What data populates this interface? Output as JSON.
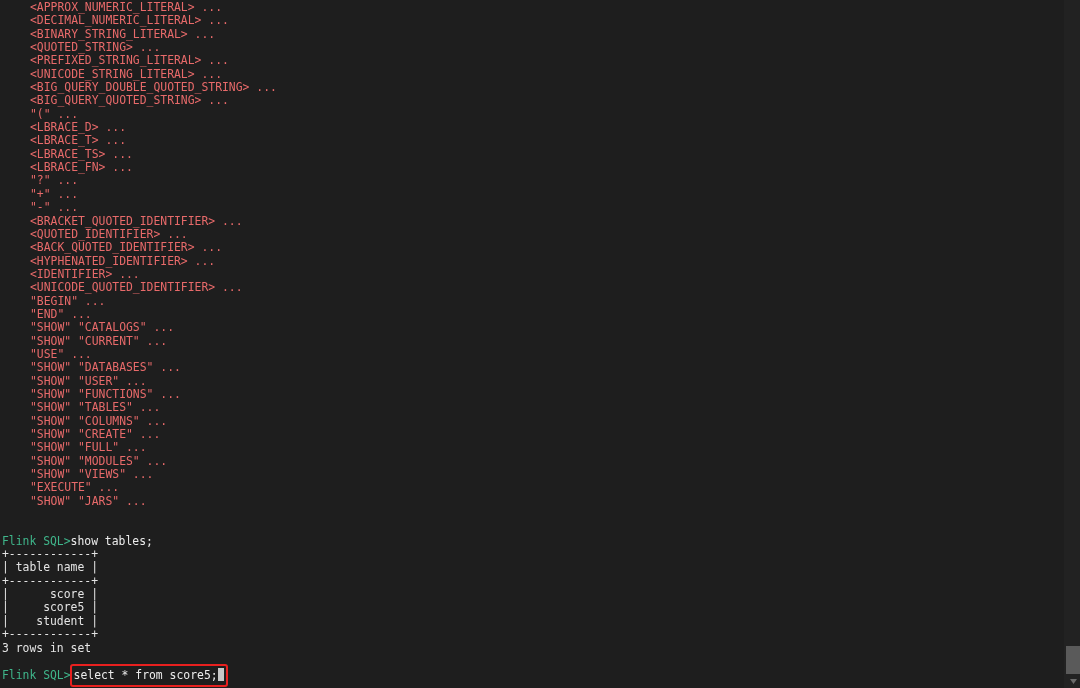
{
  "error_lines": [
    "<APPROX_NUMERIC_LITERAL> ...",
    "<DECIMAL_NUMERIC_LITERAL> ...",
    "<BINARY_STRING_LITERAL> ...",
    "<QUOTED_STRING> ...",
    "<PREFIXED_STRING_LITERAL> ...",
    "<UNICODE_STRING_LITERAL> ...",
    "<BIG_QUERY_DOUBLE_QUOTED_STRING> ...",
    "<BIG_QUERY_QUOTED_STRING> ...",
    "\"(\" ...",
    "<LBRACE_D> ...",
    "<LBRACE_T> ...",
    "<LBRACE_TS> ...",
    "<LBRACE_FN> ...",
    "\"?\" ...",
    "\"+\" ...",
    "\"-\" ...",
    "<BRACKET_QUOTED_IDENTIFIER> ...",
    "<QUOTED_IDENTIFIER> ...",
    "<BACK_QUOTED_IDENTIFIER> ...",
    "<HYPHENATED_IDENTIFIER> ...",
    "<IDENTIFIER> ...",
    "<UNICODE_QUOTED_IDENTIFIER> ...",
    "\"BEGIN\" ...",
    "\"END\" ...",
    "\"SHOW\" \"CATALOGS\" ...",
    "\"SHOW\" \"CURRENT\" ...",
    "\"USE\" ...",
    "\"SHOW\" \"DATABASES\" ...",
    "\"SHOW\" \"USER\" ...",
    "\"SHOW\" \"FUNCTIONS\" ...",
    "\"SHOW\" \"TABLES\" ...",
    "\"SHOW\" \"COLUMNS\" ...",
    "\"SHOW\" \"CREATE\" ...",
    "\"SHOW\" \"FULL\" ...",
    "\"SHOW\" \"MODULES\" ...",
    "\"SHOW\" \"VIEWS\" ...",
    "\"EXECUTE\" ...",
    "\"SHOW\" \"JARS\" ..."
  ],
  "first_command": {
    "prompt": "Flink SQL>",
    "command": "show tables;",
    "highlighted": false
  },
  "table_lines": [
    "+------------+",
    "| table name |",
    "+------------+",
    "|      score |",
    "|     score5 |",
    "|    student |",
    "+------------+"
  ],
  "summary": "3 rows in set",
  "second_command": {
    "prompt": "Flink SQL>",
    "command": "select * from score5;",
    "highlighted": true
  }
}
